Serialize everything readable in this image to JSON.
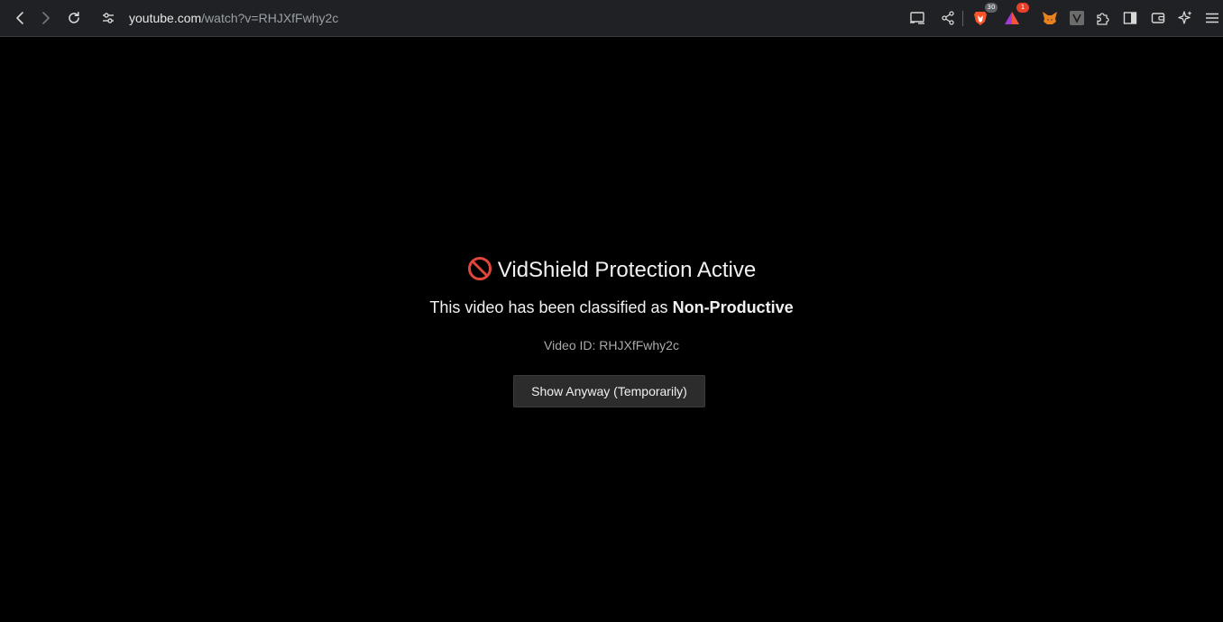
{
  "browser": {
    "url_host": "youtube.com",
    "url_path": "/watch?v=RHJXfFwhy2c",
    "brave_shields_badge": "30",
    "rewards_badge": "1",
    "icons": [
      "back-icon",
      "forward-icon",
      "reload-icon",
      "site-info-icon",
      "cast-icon",
      "share-icon",
      "brave-shields-icon",
      "brave-rewards-icon",
      "metamask-fox-icon",
      "v-extension-icon",
      "extensions-puzzle-icon",
      "sidebar-icon",
      "wallet-icon",
      "leo-ai-icon",
      "menu-icon"
    ],
    "colors": {
      "toolbar_bg": "#202124",
      "shields_orange": "#fb542b",
      "rewards_badge": "#e8402a"
    }
  },
  "overlay": {
    "ban_icon": "no-entry-sign-icon",
    "title": "VidShield Protection Active",
    "subtitle_prefix": "This video has been classified as",
    "subtitle_emphasis": "Non-Productive",
    "video_id_label": "Video ID: RHJXfFwhy2c",
    "button_label": "Show Anyway (Temporarily)",
    "colors": {
      "background": "#000000",
      "text": "#f1f1f1",
      "muted": "#aaaaaa",
      "button_bg": "#2c2c2c",
      "ban_red": "#e0463a"
    }
  }
}
